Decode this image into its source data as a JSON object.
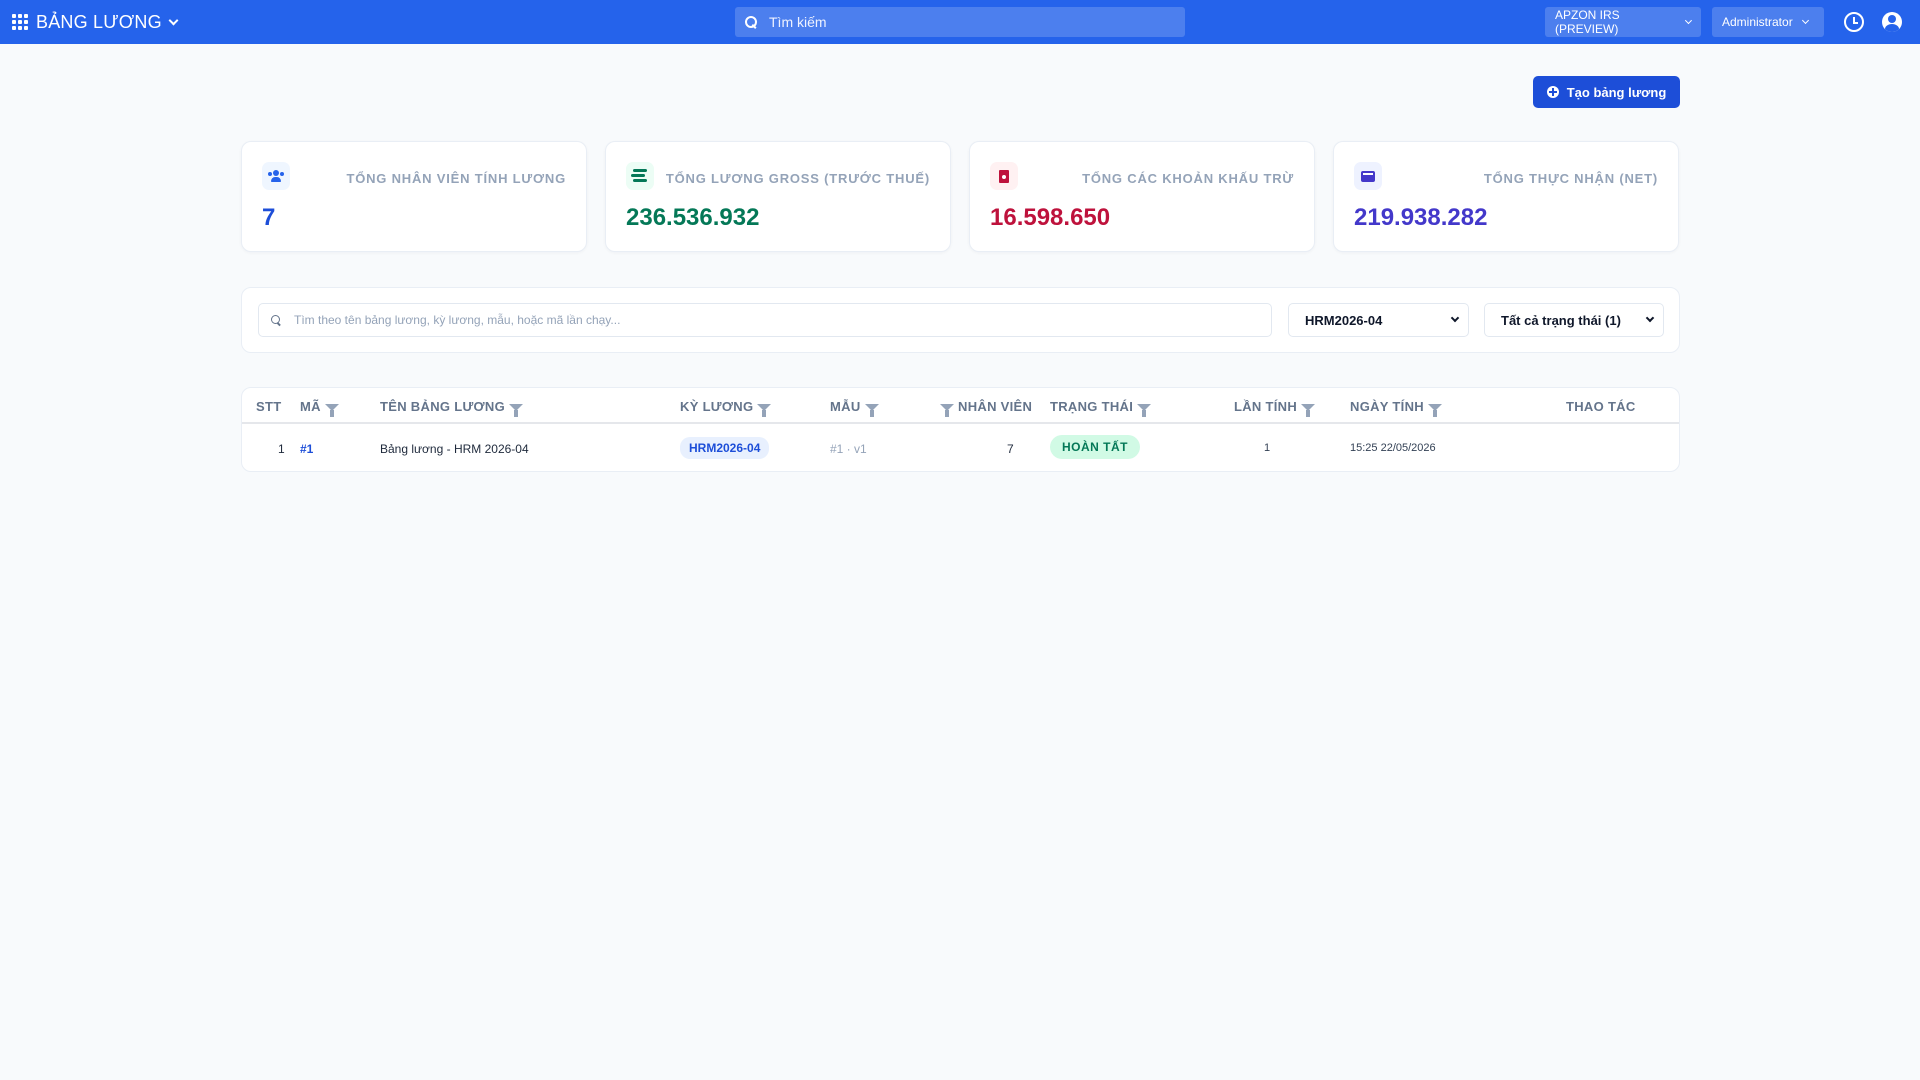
{
  "app": {
    "title": "BẢNG LƯƠNG"
  },
  "topbar": {
    "search_placeholder": "Tìm kiếm",
    "company": "APZON IRS (PREVIEW)",
    "user": "Administrator"
  },
  "actions": {
    "create_label": "Tạo bảng lương"
  },
  "stats": [
    {
      "label": "TỔNG NHÂN VIÊN TÍNH LƯƠNG",
      "value": "7",
      "color": "#1d4ed8",
      "icon": "users-icon"
    },
    {
      "label": "TỔNG LƯƠNG GROSS (TRƯỚC THUẾ)",
      "value": "236.536.932",
      "color": "#047857",
      "icon": "money-stack-icon"
    },
    {
      "label": "TỔNG CÁC KHOẢN KHẤU TRỪ",
      "value": "16.598.650",
      "color": "#be123c",
      "icon": "invoice-icon"
    },
    {
      "label": "TỔNG THỰC NHẬN (NET)",
      "value": "219.938.282",
      "color": "#4338ca",
      "icon": "wallet-icon"
    }
  ],
  "filters": {
    "search_placeholder": "Tìm theo tên bảng lương, kỳ lương, mẫu, hoặc mã lần chạy...",
    "period": "HRM2026-04",
    "status": "Tất cả trạng thái (1)"
  },
  "table": {
    "headers": {
      "stt": "STT",
      "ma": "MÃ",
      "ten": "TÊN BẢNG LƯƠNG",
      "ky": "KỲ LƯƠNG",
      "mau": "MẪU",
      "nhanvien": "NHÂN VIÊN",
      "trangthai": "TRẠNG THÁI",
      "lantinh": "LẦN TÍNH",
      "ngaytinh": "NGÀY TÍNH",
      "thaotac": "THAO TÁC"
    },
    "rows": [
      {
        "stt": "1",
        "ma": "#1",
        "ten": "Bảng lương - HRM 2026-04",
        "ky": "HRM2026-04",
        "mau": "#1 · v1",
        "nhanvien": "7",
        "trangthai": "HOÀN TẤT",
        "lantinh": "1",
        "ngaytinh": "15:25 22/05/2026"
      }
    ]
  },
  "colors": {
    "topbar": "#2563eb",
    "primary_button": "#1d4ed8",
    "status_complete_bg": "#d1fae5",
    "status_complete_text": "#047857"
  }
}
